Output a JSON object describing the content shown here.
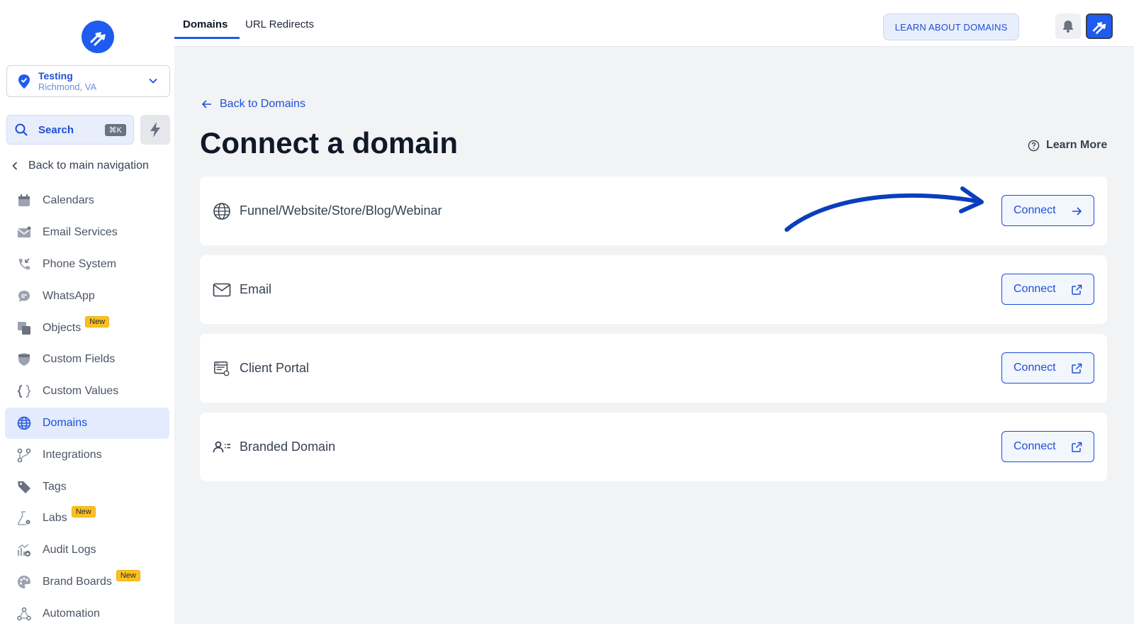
{
  "sidebar": {
    "location": {
      "name": "Testing",
      "city": "Richmond, VA"
    },
    "search": {
      "label": "Search",
      "shortcut": "⌘K"
    },
    "back_label": "Back to main navigation",
    "items": [
      {
        "label": "Calendars",
        "icon": "calendar-icon",
        "badge": ""
      },
      {
        "label": "Email Services",
        "icon": "mail-icon",
        "badge": ""
      },
      {
        "label": "Phone System",
        "icon": "phone-icon",
        "badge": ""
      },
      {
        "label": "WhatsApp",
        "icon": "chat-icon",
        "badge": ""
      },
      {
        "label": "Objects",
        "icon": "objects-icon",
        "badge": "New"
      },
      {
        "label": "Custom Fields",
        "icon": "shield-icon",
        "badge": ""
      },
      {
        "label": "Custom Values",
        "icon": "braces-icon",
        "badge": ""
      },
      {
        "label": "Domains",
        "icon": "globe-icon",
        "badge": ""
      },
      {
        "label": "Integrations",
        "icon": "git-branch-icon",
        "badge": ""
      },
      {
        "label": "Tags",
        "icon": "tag-icon",
        "badge": ""
      },
      {
        "label": "Labs",
        "icon": "flask-icon",
        "badge": "New"
      },
      {
        "label": "Audit Logs",
        "icon": "audit-icon",
        "badge": ""
      },
      {
        "label": "Brand Boards",
        "icon": "palette-icon",
        "badge": "New"
      },
      {
        "label": "Automation",
        "icon": "automation-icon",
        "badge": ""
      }
    ],
    "active_item": "Domains"
  },
  "header": {
    "tabs": [
      {
        "label": "Domains"
      },
      {
        "label": "URL Redirects"
      }
    ],
    "learn_button": "LEARN ABOUT DOMAINS"
  },
  "main": {
    "back_link": "Back to Domains",
    "title": "Connect a domain",
    "learn_more": "Learn More",
    "cards": [
      {
        "label": "Funnel/Website/Store/Blog/Webinar",
        "icon": "globe-icon",
        "button": "Connect",
        "button_icon": "arrow-right-icon"
      },
      {
        "label": "Email",
        "icon": "mail-icon",
        "button": "Connect",
        "button_icon": "external-link-icon"
      },
      {
        "label": "Client Portal",
        "icon": "portal-icon",
        "button": "Connect",
        "button_icon": "external-link-icon"
      },
      {
        "label": "Branded Domain",
        "icon": "user-list-icon",
        "button": "Connect",
        "button_icon": "external-link-icon"
      }
    ]
  },
  "colors": {
    "accent": "#1e4fd8",
    "badge": "#fbbf24",
    "background": "#f2f3f5"
  }
}
